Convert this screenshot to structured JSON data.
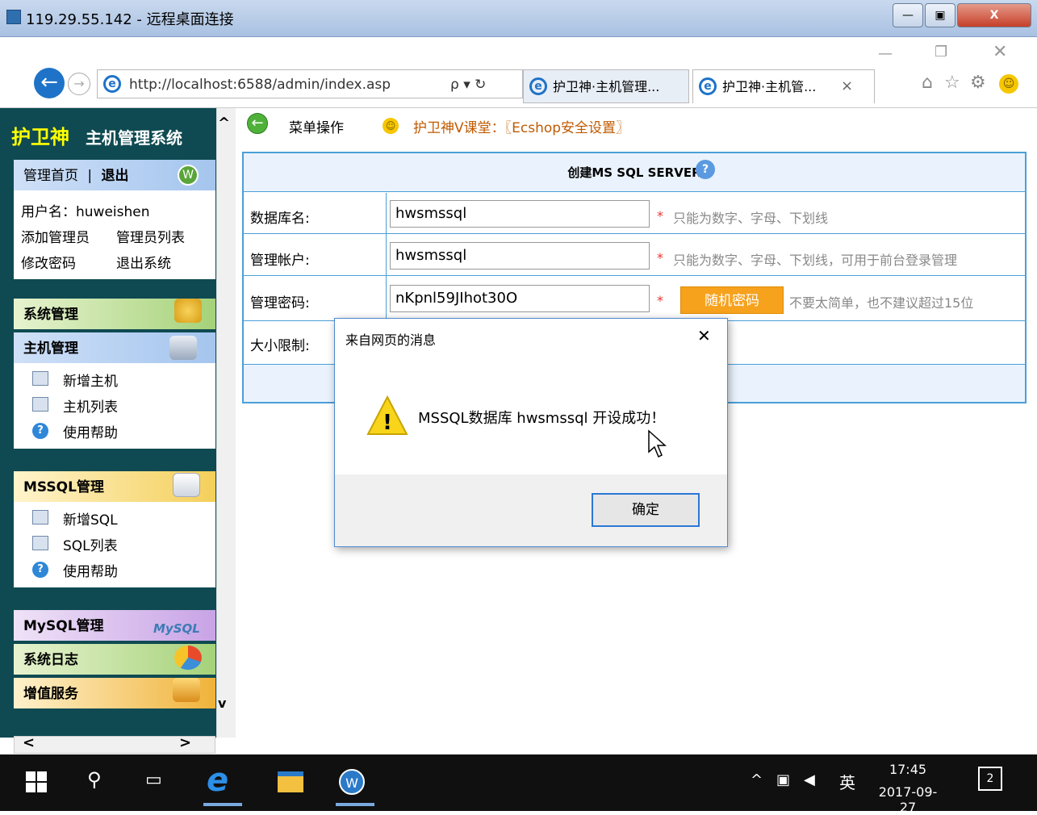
{
  "rdp": {
    "title": "119.29.55.142 - 远程桌面连接"
  },
  "browser": {
    "address": "http://localhost:6588/admin/index.asp",
    "search_glyph": "ρ ▾ ↻",
    "tabs": [
      "护卫神·主机管理...",
      "护卫神·主机管..."
    ],
    "tab_close": "×"
  },
  "sidebar": {
    "logo_main": "护卫神",
    "logo_sub": "主机管理系统",
    "top_links": {
      "home": "管理首页",
      "separator": "|",
      "logout": "退出"
    },
    "username": "用户名：huweishen",
    "add_admin": "添加管理员",
    "admin_list": "管理员列表",
    "change_password": "修改密码",
    "exit_system": "退出系统",
    "sections": {
      "system": "系统管理",
      "host": "主机管理",
      "host_items": [
        "新增主机",
        "主机列表",
        "使用帮助"
      ],
      "mssql": "MSSQL管理",
      "mssql_items": [
        "新增SQL",
        "SQL列表",
        "使用帮助"
      ],
      "mysql": "MySQL管理",
      "mysql_logo": "MySQL",
      "syslog": "系统日志",
      "value": "增值服务"
    }
  },
  "menu": {
    "ops": "菜单操作",
    "course": "护卫神V课堂：〖Ecshop安全设置〗"
  },
  "form": {
    "title": "创建MS SQL SERVER",
    "help_mark": "?",
    "rows": [
      {
        "label": "数据库名:",
        "value": "hwsmssql",
        "note": "只能为数字、字母、下划线"
      },
      {
        "label": "管理帐户:",
        "value": "hwsmssql",
        "note": "只能为数字、字母、下划线，可用于前台登录管理"
      },
      {
        "label": "管理密码:",
        "value": "nKpnl59JIhot30O",
        "note": "不要太简单，也不建议超过15位"
      },
      {
        "label": "大小限制:"
      }
    ],
    "required_mark": "*",
    "random_btn": "随机密码"
  },
  "dialog": {
    "title": "来自网页的消息",
    "message": "MSSQL数据库 hwsmssql 开设成功！",
    "warning_mark": "!",
    "ok": "确定",
    "close": "✕"
  },
  "taskbar": {
    "time": "17:45",
    "date": "2017-09-27",
    "ime": "英",
    "notif_count": "2"
  },
  "colors": {
    "accent": "#4a9fd8",
    "sidebar_bg": "#0f4a52",
    "logo_yellow": "#ffff00",
    "random_btn": "#f6a21d"
  }
}
